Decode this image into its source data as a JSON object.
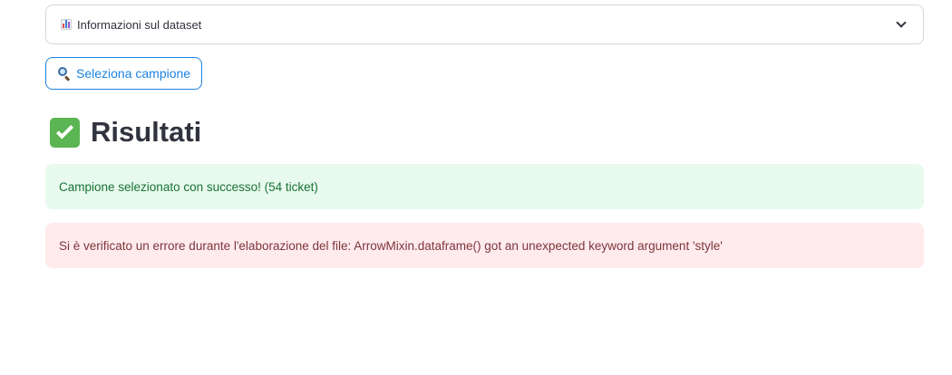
{
  "expander": {
    "icon": "bar-chart-icon",
    "label": "Informazioni sul dataset"
  },
  "button": {
    "icon": "magnifying-glass-icon",
    "label": "Seleziona campione"
  },
  "section": {
    "icon": "check-mark-button-icon",
    "title": "Risultati"
  },
  "alerts": {
    "success": "Campione selezionato con successo! (54 ticket)",
    "error": "Si è verificato un errore durante l'elaborazione del file: ArrowMixin.dataframe() got an unexpected keyword argument 'style'"
  },
  "colors": {
    "accent": "#1c83e1",
    "success_bg": "#e8f9ee",
    "success_text": "#177233",
    "error_bg": "#ffebec",
    "error_text": "#7d353b"
  }
}
